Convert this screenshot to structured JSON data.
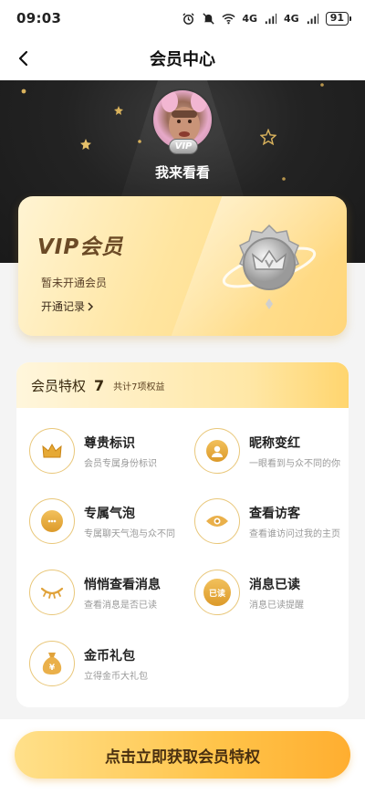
{
  "status_bar": {
    "time": "09:03",
    "signal_1": "4G",
    "signal_2": "4G",
    "battery": "91"
  },
  "nav": {
    "title": "会员中心"
  },
  "profile": {
    "username": "我来看看",
    "vip_tag": "VIP"
  },
  "vip_card": {
    "title": "VIP会员",
    "status": "暂未开通会员",
    "record_link": "开通记录"
  },
  "privileges": {
    "header_title": "会员特权",
    "count": "7",
    "total": "共计7项权益",
    "items": [
      {
        "name": "尊贵标识",
        "desc": "会员专属身份标识",
        "icon": "crown-icon"
      },
      {
        "name": "昵称变红",
        "desc": "一眼看到与众不同的你",
        "icon": "user-icon"
      },
      {
        "name": "专属气泡",
        "desc": "专属聊天气泡与众不同",
        "icon": "chat-bubble-icon"
      },
      {
        "name": "查看访客",
        "desc": "查看谁访问过我的主页",
        "icon": "eye-icon"
      },
      {
        "name": "悄悄查看消息",
        "desc": "查看消息是否已读",
        "icon": "closed-eye-icon"
      },
      {
        "name": "消息已读",
        "desc": "消息已读提醒",
        "icon": "read-badge-icon",
        "badge_text": "已读"
      },
      {
        "name": "金币礼包",
        "desc": "立得金币大礼包",
        "icon": "coin-bag-icon"
      }
    ]
  },
  "cta": {
    "label": "点击立即获取会员特权"
  },
  "colors": {
    "gold": "#f2c15c",
    "dark_header": "#232323",
    "cta_start": "#ffe08a",
    "cta_end": "#ffae30"
  }
}
